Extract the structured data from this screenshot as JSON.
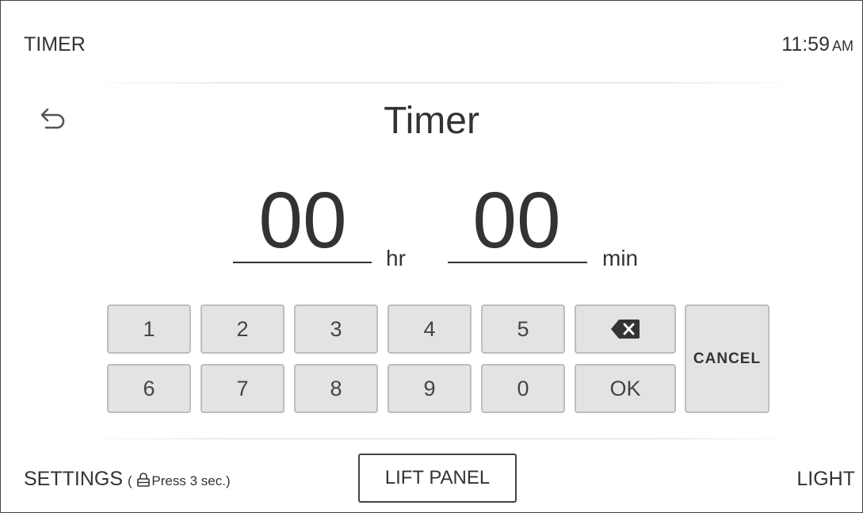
{
  "header": {
    "section_label": "TIMER",
    "clock_time": "11:59",
    "clock_ampm": "AM"
  },
  "screen": {
    "title": "Timer",
    "back_icon": "back-arrow-icon"
  },
  "timer": {
    "hours": "00",
    "hours_unit": "hr",
    "minutes": "00",
    "minutes_unit": "min"
  },
  "keypad": {
    "keys": [
      "1",
      "2",
      "3",
      "4",
      "5",
      "6",
      "7",
      "8",
      "9",
      "0"
    ],
    "backspace_icon": "backspace-icon",
    "ok_label": "OK",
    "cancel_label": "CANCEL"
  },
  "footer": {
    "settings_label": "SETTINGS",
    "settings_hint_open": "(",
    "settings_hint_text": "Press 3 sec.)",
    "lock_icon": "lock-icon",
    "lift_panel_label": "LIFT PANEL",
    "light_label": "LIGHT"
  },
  "colors": {
    "key_background": "#e3e3e3",
    "key_border": "#bdbdbd",
    "text": "#333333"
  }
}
